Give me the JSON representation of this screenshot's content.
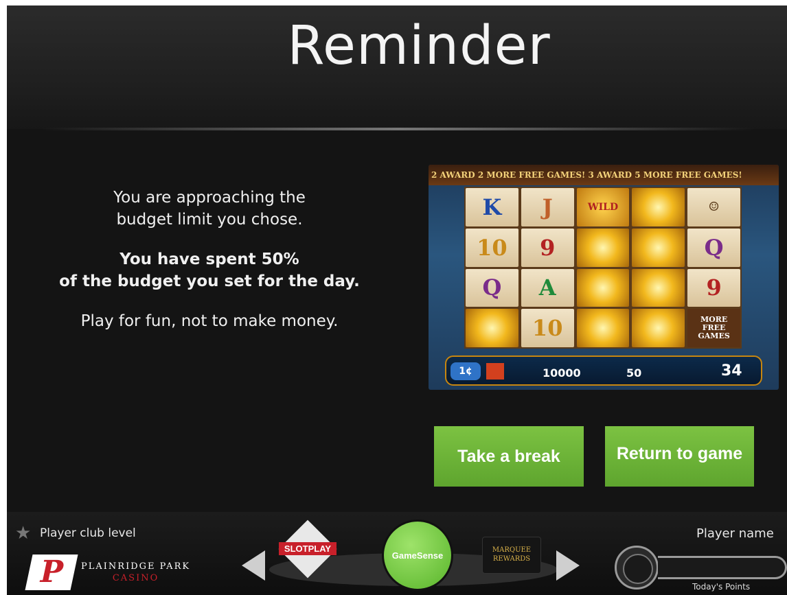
{
  "title": "Reminder",
  "message": {
    "line1": "You are approaching the",
    "line2": "budget limit you chose.",
    "bold1": "You have spent 50%",
    "bold2": "of the budget you set for the day.",
    "tagline": "Play for fun, not to make money."
  },
  "game_screenshot": {
    "banner": "2 AWARD 2 MORE FREE GAMES! 3 AWARD 5 MORE FREE GAMES!",
    "reels": [
      [
        "K",
        "10",
        "Q",
        ""
      ],
      [
        "J",
        "9",
        "A",
        "10"
      ],
      [
        "WILD",
        "",
        "",
        ""
      ],
      [
        "",
        "",
        "",
        ""
      ],
      [
        "",
        "Q",
        "9",
        "MORE FREE GAMES"
      ]
    ],
    "credit_denom": "1¢",
    "credit": "10000",
    "bet": "50",
    "win": "34"
  },
  "buttons": {
    "take_break": "Take a break",
    "return_game": "Return to game"
  },
  "footer": {
    "club_level": "Player club level",
    "casino_name": "PLAINRIDGE PARK",
    "casino_sub": "CASINO",
    "slotplay": "SLOTPLAY",
    "gamesense": "GameSense",
    "marquee": "MARQUEE REWARDS",
    "player_name": "Player name",
    "todays_points": "Today's Points"
  },
  "colors": {
    "background": "#141414",
    "button_green": "#6bb437",
    "gamesense_green": "#6fc43a"
  },
  "icons": [
    "star-icon",
    "left-arrow-icon",
    "right-arrow-icon"
  ]
}
